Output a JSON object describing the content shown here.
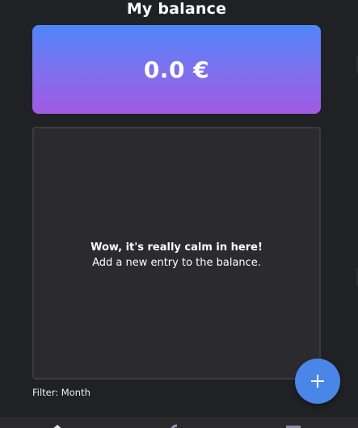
{
  "header": {
    "title": "My balance"
  },
  "balance": {
    "value": "0.0 €"
  },
  "entries": {
    "empty_title": "Wow, it's really calm in here!",
    "empty_subtitle": "Add a new entry to the balance."
  },
  "filter": {
    "label": "Filter: Month"
  },
  "fab": {
    "icon": "plus-icon"
  },
  "bottom_nav": {
    "items": [
      {
        "icon": "home-icon"
      },
      {
        "icon": "chart-icon"
      },
      {
        "icon": "calendar-icon"
      }
    ]
  },
  "colors": {
    "background": "#202124",
    "card_gradient_top": "#4f86fb",
    "card_gradient_bottom": "#a05ae2",
    "fab": "#4a86e8",
    "panel": "#2b2b2d"
  }
}
